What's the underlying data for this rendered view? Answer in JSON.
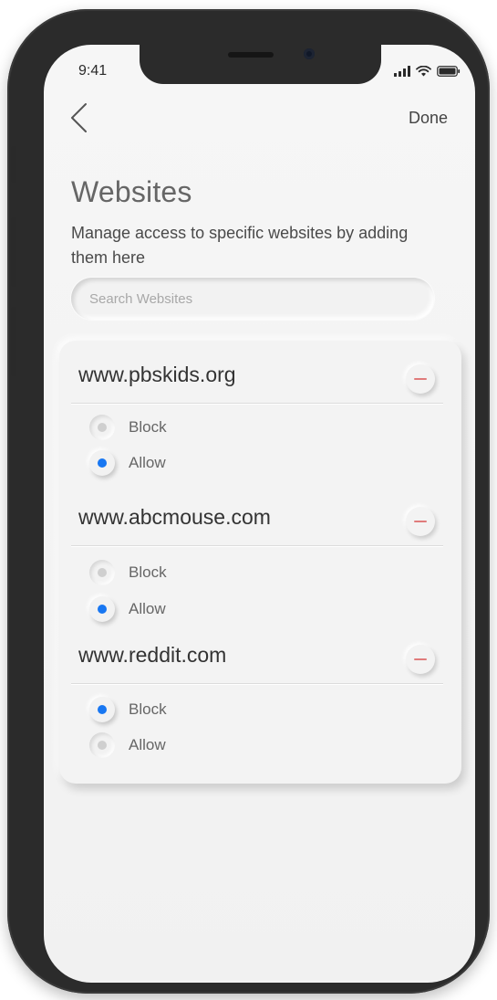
{
  "status_bar": {
    "time": "9:41",
    "icons": [
      "cellular-signal-icon",
      "wifi-icon",
      "battery-icon"
    ]
  },
  "nav": {
    "back_icon": "chevron-left-icon",
    "done_label": "Done"
  },
  "header": {
    "title": "Websites",
    "subtitle": "Manage access to specific websites by adding them here"
  },
  "search": {
    "placeholder": "Search Websites",
    "value": ""
  },
  "websites": [
    {
      "domain": "www.pbskids.org",
      "options": [
        {
          "label": "Block",
          "selected": false
        },
        {
          "label": "Allow",
          "selected": true
        }
      ]
    },
    {
      "domain": "www.abcmouse.com",
      "options": [
        {
          "label": "Block",
          "selected": false
        },
        {
          "label": "Allow",
          "selected": true
        }
      ]
    },
    {
      "domain": "www.reddit.com",
      "options": [
        {
          "label": "Block",
          "selected": true
        },
        {
          "label": "Allow",
          "selected": false
        }
      ]
    }
  ],
  "colors": {
    "accent": "#1877f2",
    "remove": "#e07b7b",
    "background": "#f3f3f3",
    "device_frame": "#2b2b2b"
  }
}
